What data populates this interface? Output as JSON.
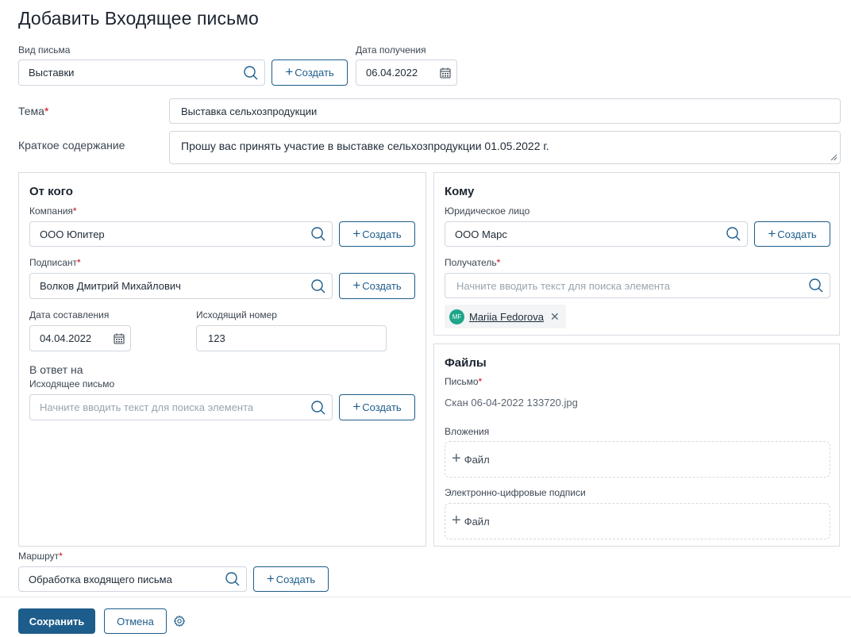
{
  "page_title": "Добавить Входящее письмо",
  "create_label": "Создать",
  "letter_type": {
    "label": "Вид письма",
    "value": "Выставки"
  },
  "received_date": {
    "label": "Дата получения",
    "value": "06.04.2022"
  },
  "subject": {
    "label": "Тема",
    "required": "*",
    "value": "Выставка сельхозпродукции"
  },
  "summary": {
    "label": "Краткое содержание",
    "value": "Прошу вас принять участие в выставке сельхозпродукции 01.05.2022 г."
  },
  "from": {
    "title": "От кого",
    "company": {
      "label": "Компания",
      "required": "*",
      "value": "ООО Юпитер"
    },
    "signer": {
      "label": "Подписант",
      "required": "*",
      "value": "Волков Дмитрий Михайлович"
    },
    "compose_date": {
      "label": "Дата составления",
      "value": "04.04.2022"
    },
    "outgoing_number": {
      "label": "Исходящий номер",
      "value": "123"
    },
    "reply_to": {
      "label": "В ответ на"
    },
    "outgoing_letter": {
      "label": "Исходящее письмо",
      "placeholder": "Начните вводить текст для поиска элемента"
    }
  },
  "to": {
    "title": "Кому",
    "legal_entity": {
      "label": "Юридическое лицо",
      "value": "ООО Марс"
    },
    "recipient": {
      "label": "Получатель",
      "required": "*",
      "placeholder": "Начните вводить текст для поиска элемента"
    },
    "chip": {
      "initials": "MF",
      "name": "Mariia Fedorova",
      "remove": "✕"
    }
  },
  "files": {
    "title": "Файлы",
    "letter": {
      "label": "Письмо",
      "required": "*",
      "value": "Скан 06-04-2022 133720.jpg"
    },
    "attachments": {
      "label": "Вложения",
      "add_label": "Файл"
    },
    "signatures": {
      "label": "Электронно-цифровые подписи",
      "add_label": "Файл"
    }
  },
  "route": {
    "label": "Маршрут",
    "required": "*",
    "value": "Обработка входящего письма"
  },
  "footer": {
    "save_label": "Сохранить",
    "cancel_label": "Отмена"
  },
  "colors": {
    "accent": "#1d5d8b",
    "required": "#d0021b",
    "avatar": "#1ea58a"
  }
}
